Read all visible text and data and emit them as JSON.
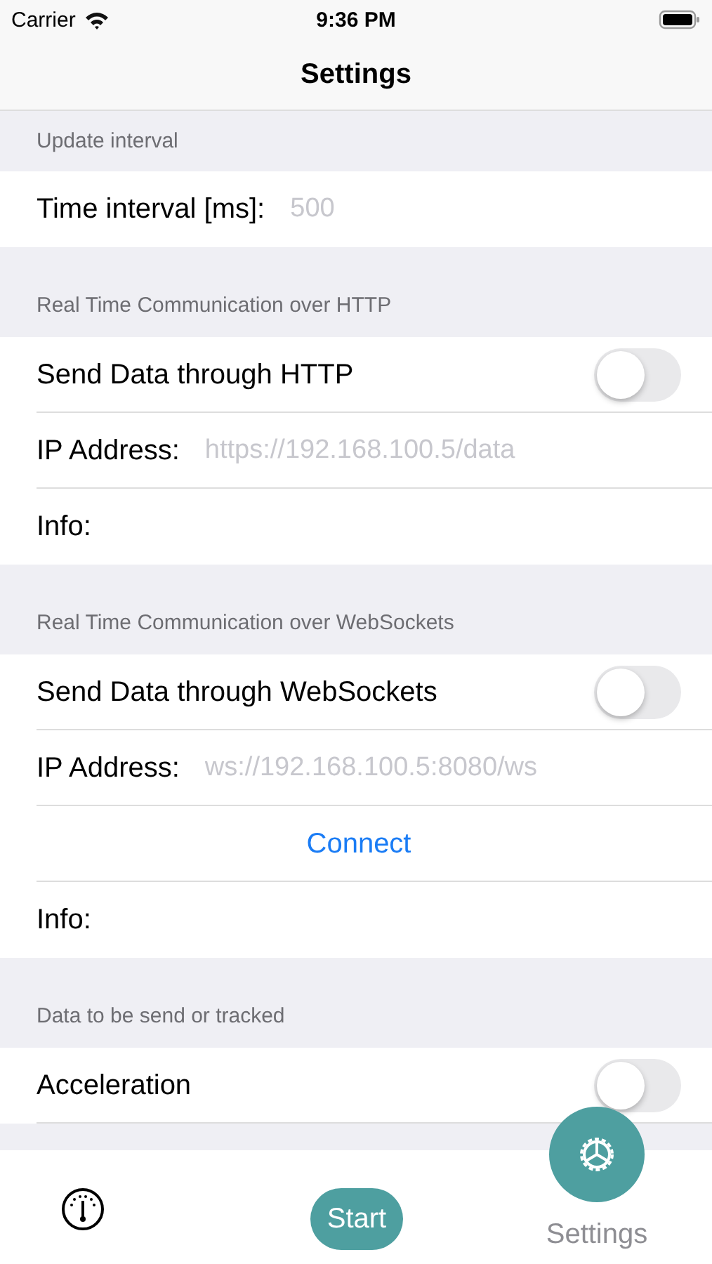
{
  "status_bar": {
    "carrier": "Carrier",
    "time": "9:36 PM"
  },
  "nav_bar": {
    "title": "Settings"
  },
  "sections": [
    {
      "header": "Update interval",
      "rows": [
        {
          "kind": "field",
          "label": "Time interval [ms]:",
          "placeholder": "500"
        }
      ]
    },
    {
      "header": "Real Time Communication over HTTP",
      "rows": [
        {
          "kind": "toggle",
          "label": "Send Data through HTTP",
          "on": false
        },
        {
          "kind": "field",
          "label": "IP Address:",
          "placeholder": "https://192.168.100.5/data"
        },
        {
          "kind": "info",
          "label": "Info:"
        }
      ]
    },
    {
      "header": "Real Time Communication over WebSockets",
      "rows": [
        {
          "kind": "toggle",
          "label": "Send Data through WebSockets",
          "on": false
        },
        {
          "kind": "field",
          "label": "IP Address:",
          "placeholder": "ws://192.168.100.5:8080/ws"
        },
        {
          "kind": "action",
          "label": "Connect"
        },
        {
          "kind": "info",
          "label": "Info:"
        }
      ]
    },
    {
      "header": "Data to be send or tracked",
      "rows": [
        {
          "kind": "toggle",
          "label": "Acceleration",
          "on": false
        }
      ]
    }
  ],
  "tab_bar": {
    "start": "Start",
    "settings": {
      "label": "Settings",
      "selected": true
    }
  }
}
